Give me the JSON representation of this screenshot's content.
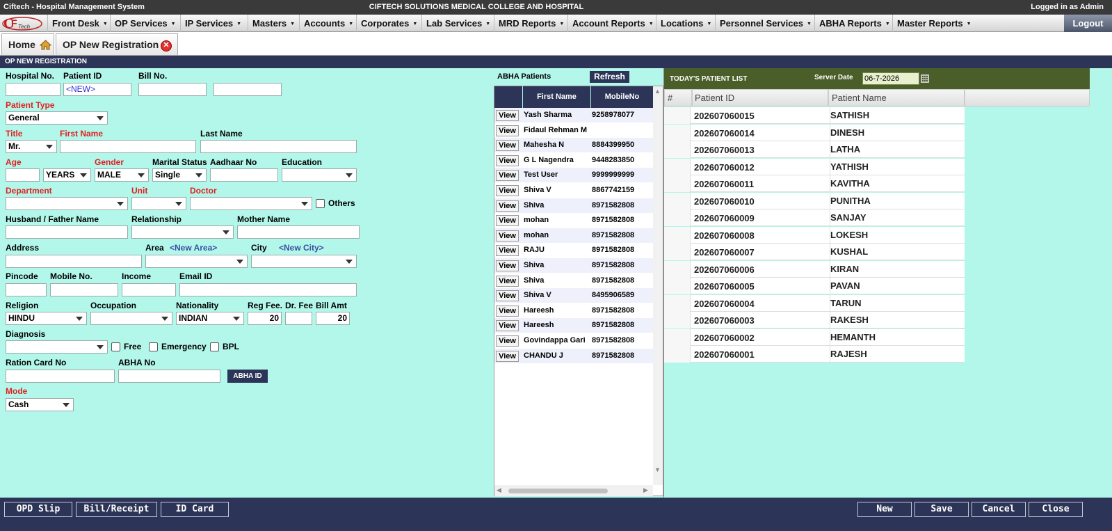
{
  "topbar": {
    "left": "Ciftech - Hospital Management System",
    "center": "CIFTECH SOLUTIONS MEDICAL COLLEGE AND HOSPITAL",
    "right": "Logged in as Admin"
  },
  "logo_text": "Tech",
  "menu": [
    "Front Desk",
    "OP Services",
    "IP Services",
    "Masters",
    "Accounts",
    "Corporates",
    "Lab Services",
    "MRD Reports",
    "Account Reports",
    "Locations",
    "Personnel Services",
    "ABHA Reports",
    "Master Reports"
  ],
  "logout": "Logout",
  "tabs": {
    "home": "Home",
    "active": "OP New Registration"
  },
  "section_title": "OP NEW REGISTRATION",
  "form": {
    "hospital_no": "Hospital No.",
    "patient_id": "Patient ID",
    "patient_id_value": "<NEW>",
    "bill_no": "Bill No.",
    "patient_type": "Patient Type",
    "patient_type_value": "General",
    "title": "Title",
    "title_value": "Mr.",
    "first_name": "First Name",
    "last_name": "Last Name",
    "age": "Age",
    "age_unit_value": "YEARS",
    "gender": "Gender",
    "gender_value": "MALE",
    "marital_status": "Marital Status",
    "marital_value": "Single",
    "aadhaar": "Aadhaar No",
    "education": "Education",
    "department": "Department",
    "unit": "Unit",
    "doctor": "Doctor",
    "others": "Others",
    "husband_father": "Husband / Father Name",
    "relationship": "Relationship",
    "mother_name": "Mother Name",
    "address": "Address",
    "area": "Area",
    "new_area": "<New Area>",
    "city": "City",
    "new_city": "<New City>",
    "pincode": "Pincode",
    "mobile": "Mobile No.",
    "income": "Income",
    "email": "Email ID",
    "religion": "Religion",
    "religion_value": "HINDU",
    "occupation": "Occupation",
    "nationality": "Nationality",
    "nationality_value": "INDIAN",
    "reg_fee": "Reg Fee.",
    "reg_fee_value": "20",
    "dr_fee": "Dr. Fee",
    "bill_amt": "Bill Amt",
    "bill_amt_value": "20",
    "diagnosis": "Diagnosis",
    "free": "Free",
    "emergency": "Emergency",
    "bpl": "BPL",
    "ration_card": "Ration Card No",
    "abha_no": "ABHA No",
    "abha_id_btn": "ABHA ID",
    "mode": "Mode",
    "mode_value": "Cash"
  },
  "abha": {
    "title": "ABHA Patients",
    "refresh": "Refresh",
    "col_first": "First Name",
    "col_mobile": "MobileNo",
    "view": "View",
    "rows": [
      {
        "name": "Yash Sharma",
        "mobile": "9258978077"
      },
      {
        "name": "Fidaul Rehman M",
        "mobile": ""
      },
      {
        "name": "Mahesha N",
        "mobile": "8884399950"
      },
      {
        "name": "G L Nagendra",
        "mobile": "9448283850"
      },
      {
        "name": "Test User",
        "mobile": "9999999999"
      },
      {
        "name": "Shiva V",
        "mobile": "8867742159"
      },
      {
        "name": "Shiva",
        "mobile": "8971582808"
      },
      {
        "name": "mohan",
        "mobile": "8971582808"
      },
      {
        "name": "mohan",
        "mobile": "8971582808"
      },
      {
        "name": "RAJU",
        "mobile": "8971582808"
      },
      {
        "name": "Shiva",
        "mobile": "8971582808"
      },
      {
        "name": "Shiva",
        "mobile": "8971582808"
      },
      {
        "name": "Shiva V",
        "mobile": "8495906589"
      },
      {
        "name": "Hareesh",
        "mobile": "8971582808"
      },
      {
        "name": "Hareesh",
        "mobile": "8971582808"
      },
      {
        "name": "Govindappa Gari",
        "mobile": "8971582808"
      },
      {
        "name": "CHANDU J",
        "mobile": "8971582808"
      }
    ]
  },
  "patients": {
    "title": "TODAY'S PATIENT LIST",
    "server_date_label": "Server Date",
    "server_date": "06-7-2026",
    "col_num": "#",
    "col_id": "Patient ID",
    "col_name": "Patient Name",
    "rows": [
      {
        "id": "202607060015",
        "name": "SATHISH"
      },
      {
        "id": "202607060014",
        "name": "DINESH"
      },
      {
        "id": "202607060013",
        "name": "LATHA"
      },
      {
        "id": "202607060012",
        "name": "YATHISH"
      },
      {
        "id": "202607060011",
        "name": "KAVITHA"
      },
      {
        "id": "202607060010",
        "name": "PUNITHA"
      },
      {
        "id": "202607060009",
        "name": "SANJAY"
      },
      {
        "id": "202607060008",
        "name": "LOKESH"
      },
      {
        "id": "202607060007",
        "name": "KUSHAL"
      },
      {
        "id": "202607060006",
        "name": "KIRAN"
      },
      {
        "id": "202607060005",
        "name": "PAVAN"
      },
      {
        "id": "202607060004",
        "name": "TARUN"
      },
      {
        "id": "202607060003",
        "name": "RAKESH"
      },
      {
        "id": "202607060002",
        "name": "HEMANTH"
      },
      {
        "id": "202607060001",
        "name": "RAJESH"
      }
    ]
  },
  "footer": {
    "opd_slip": "OPD Slip",
    "bill_receipt": "Bill/Receipt",
    "id_card": "ID Card",
    "new": "New",
    "save": "Save",
    "cancel": "Cancel",
    "close": "Close"
  }
}
